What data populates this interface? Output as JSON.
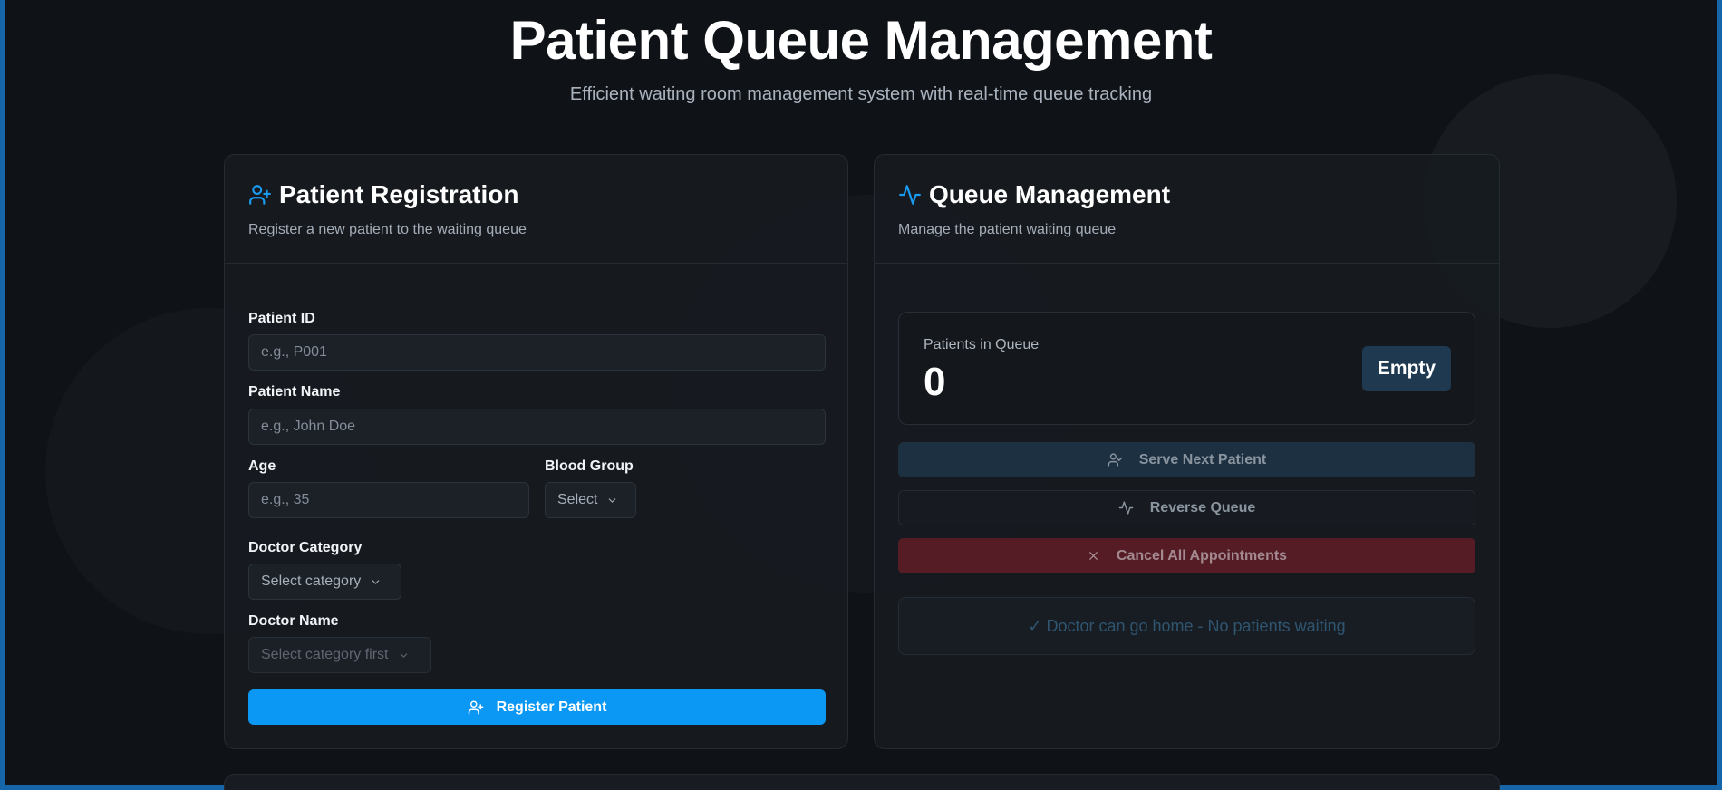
{
  "header": {
    "title": "Patient Queue Management",
    "subtitle": "Efficient waiting room management system with real-time queue tracking"
  },
  "registration": {
    "title": "Patient Registration",
    "description": "Register a new patient to the waiting queue",
    "patient_id": {
      "label": "Patient ID",
      "placeholder": "e.g., P001",
      "value": ""
    },
    "patient_name": {
      "label": "Patient Name",
      "placeholder": "e.g., John Doe",
      "value": ""
    },
    "age": {
      "label": "Age",
      "placeholder": "e.g., 35",
      "value": ""
    },
    "blood_group": {
      "label": "Blood Group",
      "selected": "Select"
    },
    "doctor_category": {
      "label": "Doctor Category",
      "selected": "Select category"
    },
    "doctor_name": {
      "label": "Doctor Name",
      "selected": "Select category first"
    },
    "register_button": "Register Patient"
  },
  "queue": {
    "title": "Queue Management",
    "description": "Manage the patient waiting queue",
    "count_label": "Patients in Queue",
    "count": "0",
    "status_badge": "Empty",
    "serve_button": "Serve Next Patient",
    "reverse_button": "Reverse Queue",
    "cancel_button": "Cancel All Appointments",
    "status_message": "✓ Doctor can go home - No patients waiting"
  },
  "colors": {
    "accent": "#0b97f4",
    "background": "#0f1318",
    "danger": "#561c25",
    "frame": "#1565a8"
  },
  "icons": {
    "registration": "user-plus-icon",
    "queue": "activity-icon",
    "serve": "user-check-icon",
    "reverse": "activity-icon",
    "cancel": "x-icon",
    "dropdown": "chevron-down-icon"
  }
}
